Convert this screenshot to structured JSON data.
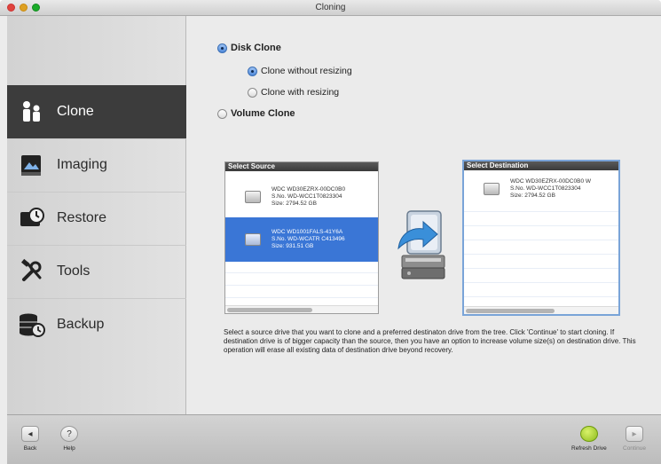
{
  "window": {
    "title": "Cloning"
  },
  "sidebar": {
    "items": [
      {
        "label": "Clone",
        "icon": "clone-person-icon",
        "active": true
      },
      {
        "label": "Imaging",
        "icon": "imaging-icon",
        "active": false
      },
      {
        "label": "Restore",
        "icon": "restore-icon",
        "active": false
      },
      {
        "label": "Tools",
        "icon": "tools-icon",
        "active": false
      },
      {
        "label": "Backup",
        "icon": "backup-icon",
        "active": false
      }
    ]
  },
  "options": {
    "disk_clone": {
      "label": "Disk Clone",
      "checked": true
    },
    "without_resizing": {
      "label": "Clone without resizing",
      "checked": true
    },
    "with_resizing": {
      "label": "Clone with resizing",
      "checked": false
    },
    "volume_clone": {
      "label": "Volume Clone",
      "checked": false
    }
  },
  "source": {
    "header": "Select Source",
    "drives": [
      {
        "line1": "WDC WD30EZRX-00DC0B0",
        "line2": "S.No. WD-WCC1T0823304",
        "line3": "Size: 2794.52 GB",
        "selected": false
      },
      {
        "line1": "WDC WD1001FALS-41Y6A",
        "line2": "S.No. WD-WCATR C413496",
        "line3": "Size: 931.51 GB",
        "selected": true
      }
    ]
  },
  "destination": {
    "header": "Select Destination",
    "drives": [
      {
        "line1": "WDC WD30EZRX-00DC0B0 W",
        "line2": "S.No. WD-WCC1T0823304",
        "line3": "Size: 2794.52 GB",
        "selected": false
      }
    ]
  },
  "description": "Select a source drive that you want to clone and a preferred destinaton drive from the tree. Click 'Continue' to start cloning. If destination drive is of bigger capacity than the source, then you have an option to increase volume size(s) on destination drive. This operation will erase all existing data of destination drive beyond recovery.",
  "toolbar": {
    "back": "Back",
    "help": "Help",
    "refresh": "Refresh Drive",
    "continue": "Continue"
  },
  "colors": {
    "selection": "#3a76d6",
    "sidebar_active": "#3c3c3c",
    "refresh": "#a6cf2a"
  }
}
